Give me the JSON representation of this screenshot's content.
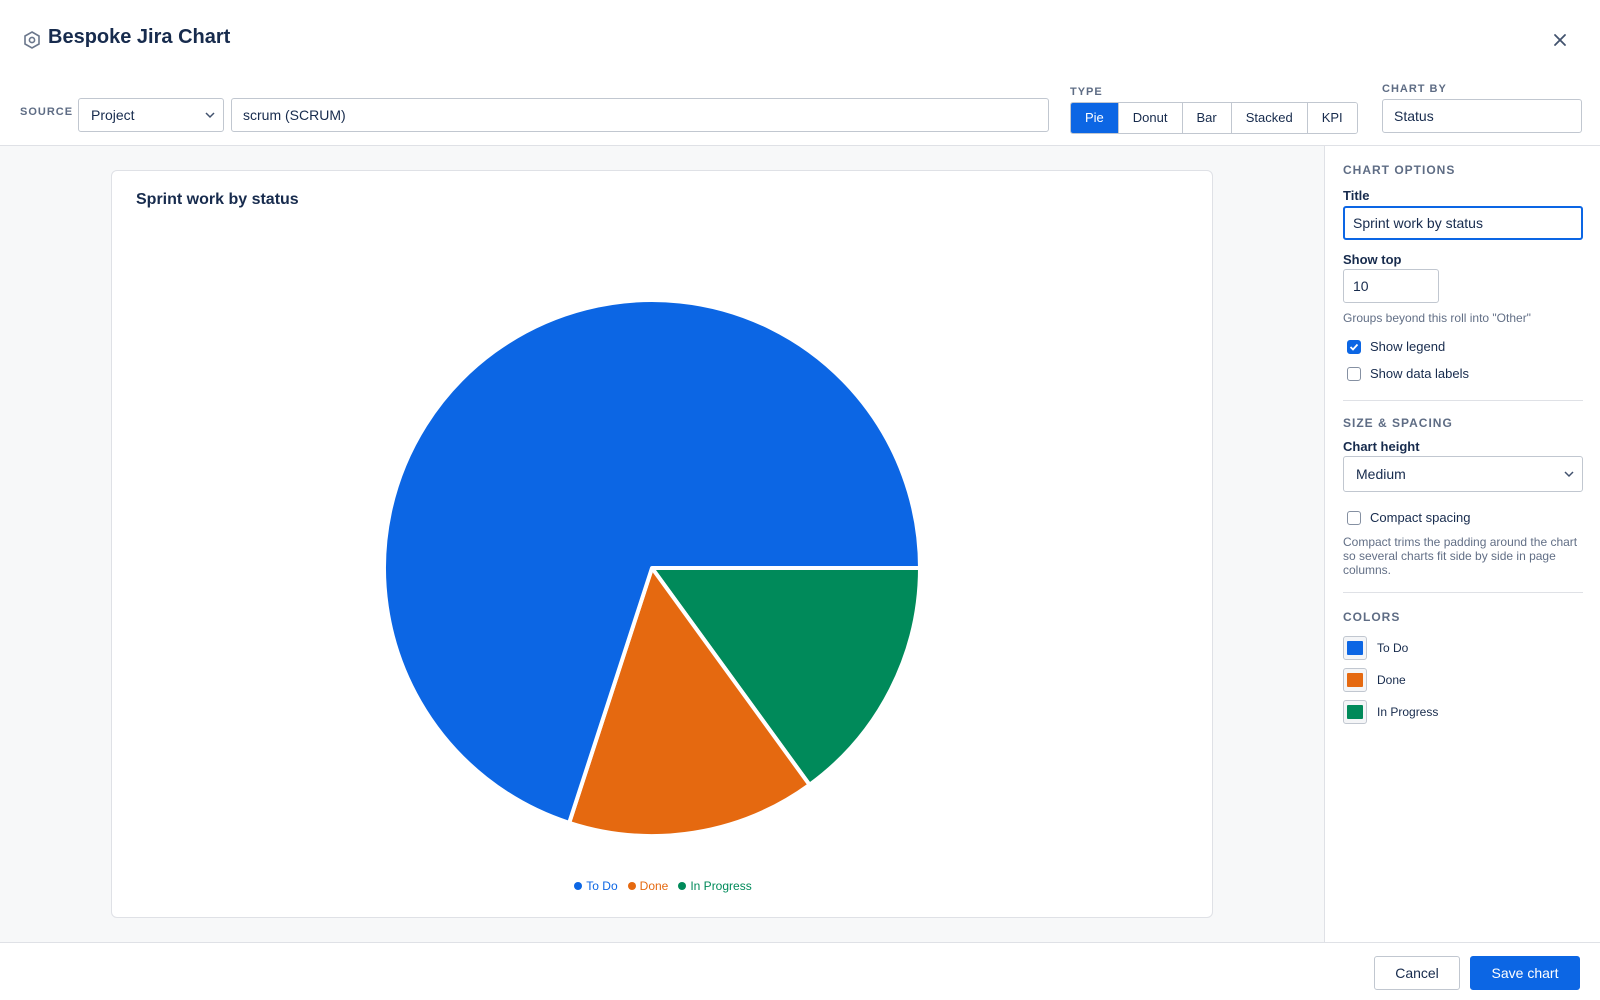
{
  "app": {
    "title": "Bespoke Jira Chart",
    "icon": "settings-hex-icon"
  },
  "toolbar": {
    "source_label": "SOURCE",
    "source_value": "Project",
    "project_value": "scrum (SCRUM)",
    "type_label": "TYPE",
    "type_options": [
      "Pie",
      "Donut",
      "Bar",
      "Stacked",
      "KPI"
    ],
    "type_selected": "Pie",
    "chart_by_label": "CHART BY",
    "chart_by_value": "Status"
  },
  "chart": {
    "title": "Sprint work by status"
  },
  "chart_data": {
    "type": "pie",
    "title": "Sprint work by status",
    "categories": [
      "To Do",
      "Done",
      "In Progress"
    ],
    "values": [
      70,
      15,
      15
    ],
    "colors": [
      "#0c66e4",
      "#e56910",
      "#008a5a"
    ],
    "legend": "bottom-center",
    "data_labels": false
  },
  "sidebar": {
    "chart_options_heading": "CHART OPTIONS",
    "title_label": "Title",
    "title_value": "Sprint work by status",
    "show_top_label": "Show top",
    "show_top_value": "10",
    "show_top_hint": "Groups beyond this roll into \"Other\"",
    "show_legend_label": "Show legend",
    "show_legend_checked": true,
    "show_data_labels_label": "Show data labels",
    "show_data_labels_checked": false,
    "size_heading": "SIZE & SPACING",
    "chart_height_label": "Chart height",
    "chart_height_value": "Medium",
    "compact_label": "Compact spacing",
    "compact_checked": false,
    "compact_hint": "Compact trims the padding around the chart so several charts fit side by side in page columns.",
    "colors_heading": "COLORS",
    "colors": [
      {
        "label": "To Do",
        "color": "#0c66e4"
      },
      {
        "label": "Done",
        "color": "#e56910"
      },
      {
        "label": "In Progress",
        "color": "#008a5a"
      }
    ]
  },
  "footer": {
    "cancel_label": "Cancel",
    "save_label": "Save chart"
  }
}
